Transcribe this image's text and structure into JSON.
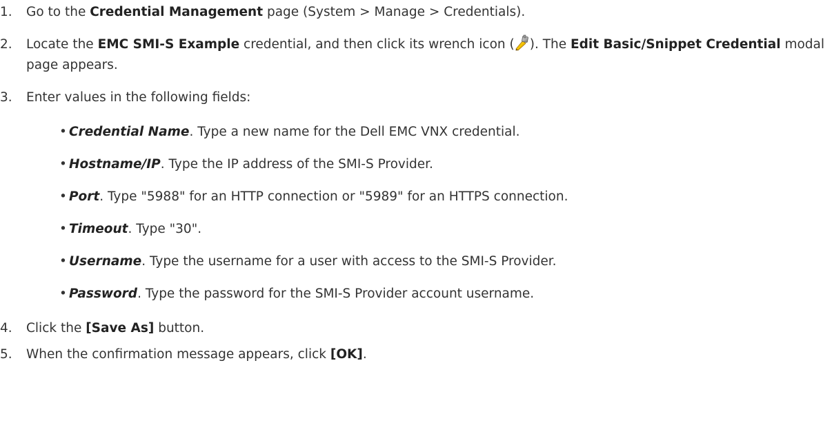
{
  "steps": [
    {
      "num": "1.",
      "pre": "Go to the ",
      "bold1": "Credential Management",
      "post": " page (System > Manage > Credentials)."
    },
    {
      "num": "2.",
      "pre": "Locate the ",
      "bold1": "EMC SMI-S Example",
      "mid1": " credential, and then click its wrench icon (",
      "mid2": "). The ",
      "bold2": "Edit Basic/Snippet Credential",
      "post": " modal page appears."
    },
    {
      "num": "3.",
      "text": "Enter values in the following fields:"
    },
    {
      "num": "4.",
      "pre": "Click the ",
      "bold1": "[Save As]",
      "post": " button."
    },
    {
      "num": "5.",
      "pre": "When the confirmation message appears, click ",
      "bold1": "[OK]",
      "post": "."
    }
  ],
  "fields": [
    {
      "name": "Credential Name",
      "desc": ". Type a new name for the Dell EMC VNX credential."
    },
    {
      "name": "Hostname/IP",
      "desc": ". Type the IP address of the SMI-S Provider."
    },
    {
      "name": "Port",
      "desc": ". Type \"5988\" for an HTTP connection or \"5989\" for an HTTPS connection."
    },
    {
      "name": "Timeout",
      "desc": ". Type \"30\"."
    },
    {
      "name": "Username",
      "desc": ". Type the username for a user with access to the SMI-S Provider."
    },
    {
      "name": "Password",
      "desc": ". Type the password for the SMI-S Provider account username."
    }
  ],
  "bullet_glyph": "•",
  "icons": {
    "wrench": "wrench-icon"
  }
}
